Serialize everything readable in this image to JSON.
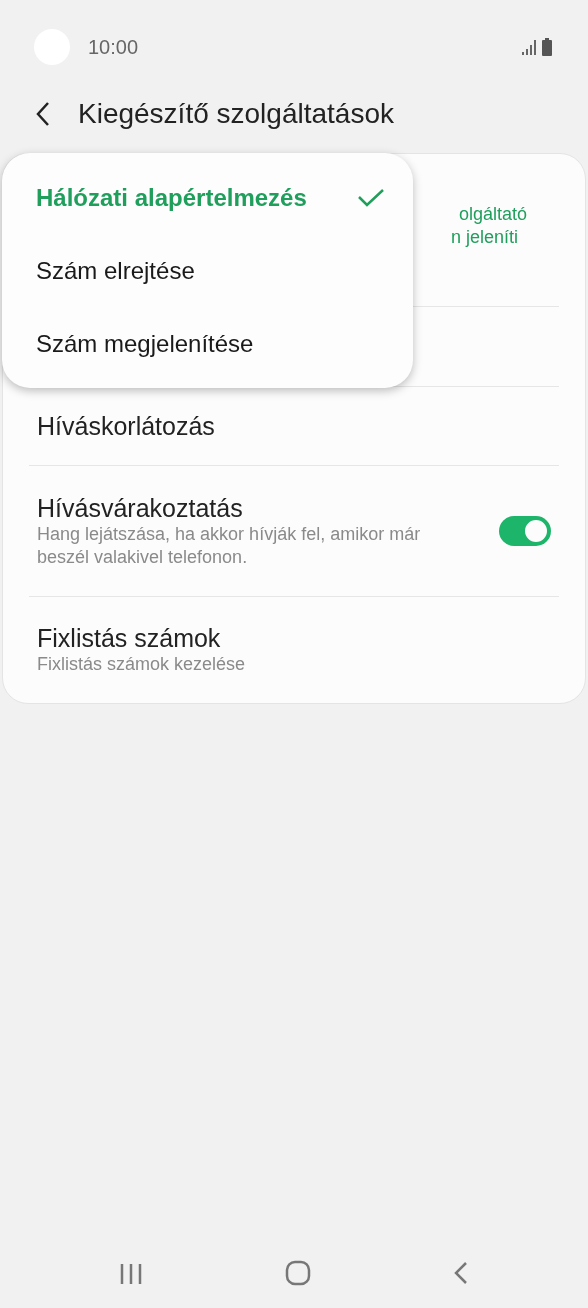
{
  "status_bar": {
    "time": "10:00"
  },
  "header": {
    "title": "Kiegészítő szolgáltatások"
  },
  "covered_row": {
    "subtitle_lines": [
      "olgáltató",
      "n jeleníti"
    ]
  },
  "settings": [
    {
      "kind": "plain",
      "title": "Híváskorlátozás"
    },
    {
      "kind": "toggle",
      "title": "Hívásvárakoztatás",
      "subtitle": "Hang lejátszása, ha akkor hívják fel, amikor már beszél valakivel telefonon.",
      "on": true
    },
    {
      "kind": "plain",
      "title": "Fixlistás számok",
      "subtitle": "Fixlistás számok kezelése"
    }
  ],
  "popup_menu": [
    {
      "label": "Hálózati alapértelmezés",
      "selected": true
    },
    {
      "label": "Szám elrejtése",
      "selected": false
    },
    {
      "label": "Szám megjelenítése",
      "selected": false
    }
  ]
}
